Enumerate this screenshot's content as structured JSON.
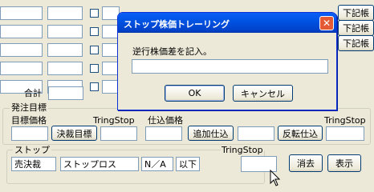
{
  "background": {
    "total_label": "合計",
    "side_buttons": [
      "下記帳",
      "下記帳",
      "下記帳"
    ]
  },
  "order_target": {
    "legend": "発注目標",
    "target_price_label": "目標価格",
    "tring_stop_label_1": "TringStop",
    "settle_target_button": "決裁目標",
    "purchase_price_label": "仕込価格",
    "tring_stop_label_2": "TringStop",
    "add_purchase_button": "追加仕込",
    "reverse_purchase_button": "反転仕込"
  },
  "stop": {
    "legend": "ストップ",
    "sell_settle_value": "売決裁",
    "stop_loss_value": "ストップロス",
    "na_value": "N／A",
    "below_value": "以下",
    "tring_stop_label": "TringStop",
    "delete_button": "消去",
    "display_button": "表示"
  },
  "dialog": {
    "title": "ストップ株価トレーリング",
    "close_glyph": "✕",
    "prompt": "逆行株価差を記入。",
    "input_value": "",
    "ok_button": "OK",
    "cancel_button": "キャンセル"
  }
}
